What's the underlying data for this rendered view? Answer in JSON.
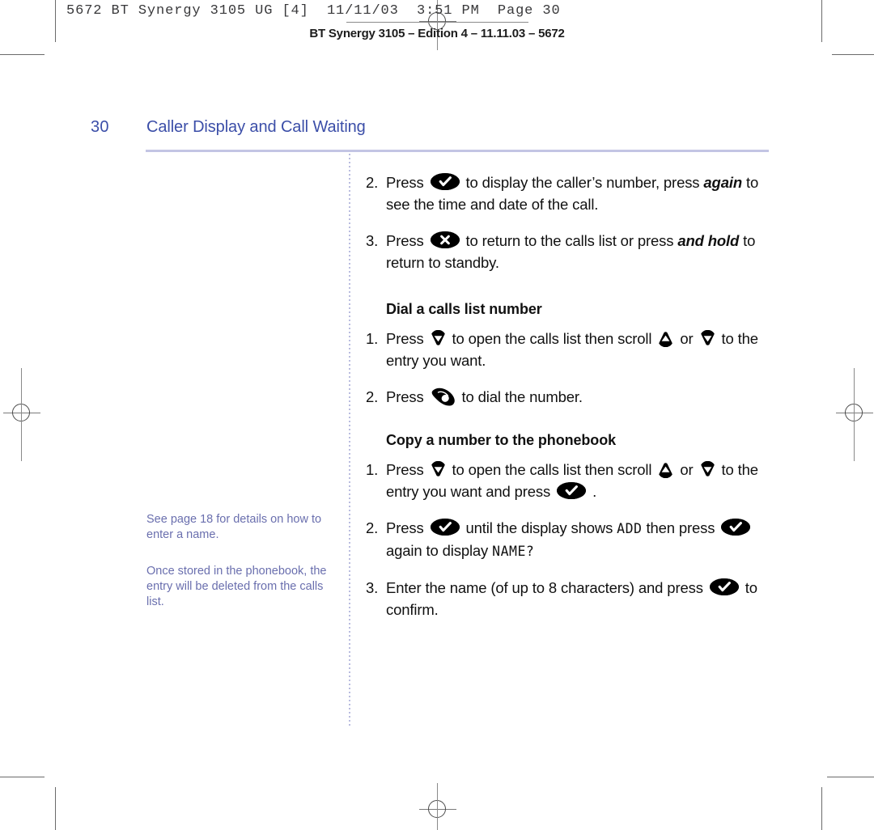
{
  "print_marks": {
    "header_line": "5672 BT Synergy 3105 UG [4]  11/11/03  3:51 PM  Page 30",
    "edition_line": "BT Synergy 3105 – Edition 4 – 11.11.03 – 5672"
  },
  "page": {
    "number": "30",
    "title": "Caller Display and Call Waiting"
  },
  "side_notes": [
    "See page 18 for details on how to enter a name.",
    "Once stored in the phonebook, the entry will be deleted from the calls list."
  ],
  "steps": {
    "intro": [
      {
        "num": "2.",
        "parts": [
          {
            "t": "text",
            "v": "Press "
          },
          {
            "t": "icon",
            "v": "ok-check-key"
          },
          {
            "t": "text",
            "v": " to display the caller’s number, press "
          },
          {
            "t": "bolditalic",
            "v": "again"
          },
          {
            "t": "text",
            "v": " to see the time and date of the call."
          }
        ]
      },
      {
        "num": "3.",
        "parts": [
          {
            "t": "text",
            "v": "Press "
          },
          {
            "t": "icon",
            "v": "cancel-x-key"
          },
          {
            "t": "text",
            "v": " to return to the calls list or press "
          },
          {
            "t": "bolditalic",
            "v": "and hold"
          },
          {
            "t": "text",
            "v": " to return to standby."
          }
        ]
      }
    ],
    "dial_section": {
      "heading": "Dial a calls list number",
      "items": [
        {
          "num": "1.",
          "parts": [
            {
              "t": "text",
              "v": "Press "
            },
            {
              "t": "icon",
              "v": "down-arrow-key"
            },
            {
              "t": "text",
              "v": " to open the calls list then scroll "
            },
            {
              "t": "icon",
              "v": "up-arrow-key"
            },
            {
              "t": "text",
              "v": " or "
            },
            {
              "t": "icon",
              "v": "down-arrow-key"
            },
            {
              "t": "text",
              "v": " to the entry you want."
            }
          ]
        },
        {
          "num": "2.",
          "parts": [
            {
              "t": "text",
              "v": "Press "
            },
            {
              "t": "icon",
              "v": "dial-handset-key"
            },
            {
              "t": "text",
              "v": " to dial the number."
            }
          ]
        }
      ]
    },
    "copy_section": {
      "heading": "Copy a number to the phonebook",
      "items": [
        {
          "num": "1.",
          "parts": [
            {
              "t": "text",
              "v": "Press "
            },
            {
              "t": "icon",
              "v": "down-arrow-key"
            },
            {
              "t": "text",
              "v": " to open the calls list then scroll "
            },
            {
              "t": "icon",
              "v": "up-arrow-key"
            },
            {
              "t": "text",
              "v": " or "
            },
            {
              "t": "icon",
              "v": "down-arrow-key"
            },
            {
              "t": "text",
              "v": " to the entry you want and press "
            },
            {
              "t": "icon",
              "v": "ok-check-key"
            },
            {
              "t": "text",
              "v": " ."
            }
          ]
        },
        {
          "num": "2.",
          "parts": [
            {
              "t": "text",
              "v": "Press "
            },
            {
              "t": "icon",
              "v": "ok-check-key"
            },
            {
              "t": "text",
              "v": " until the display shows "
            },
            {
              "t": "lcd",
              "v": "ADD"
            },
            {
              "t": "text",
              "v": " then press "
            },
            {
              "t": "icon",
              "v": "ok-check-key"
            },
            {
              "t": "text",
              "v": " again to display "
            },
            {
              "t": "lcd",
              "v": "NAME?"
            }
          ]
        },
        {
          "num": "3.",
          "parts": [
            {
              "t": "text",
              "v": "Enter the name (of up to 8 characters) and press "
            },
            {
              "t": "icon",
              "v": "ok-check-key"
            },
            {
              "t": "text",
              "v": " to confirm."
            }
          ]
        }
      ]
    }
  },
  "colors": {
    "title_blue": "#3b4ea8",
    "note_purple": "#6a6fae",
    "rule_lavender": "#c3c5e4",
    "key_black": "#000000"
  }
}
